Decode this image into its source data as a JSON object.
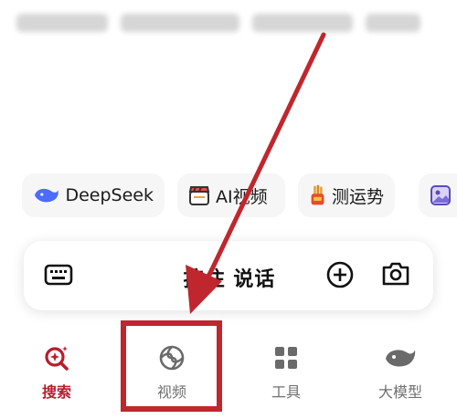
{
  "chips": [
    {
      "label": "DeepSeek",
      "icon": "whale-icon",
      "color": "#4d6bfe"
    },
    {
      "label": "AI视频",
      "icon": "clapperboard-icon",
      "color": "#e84b4b"
    },
    {
      "label": "测运势",
      "icon": "fortune-sticks-icon",
      "color": "#e8a23a"
    },
    {
      "label": "",
      "icon": "image-icon",
      "color": "#7a6bd6"
    }
  ],
  "voice": {
    "label": "按住 说话",
    "keyboard_icon": "keyboard-icon",
    "plus_icon": "plus-circle-icon",
    "camera_icon": "camera-icon"
  },
  "nav": {
    "items": [
      {
        "label": "搜索",
        "icon": "search-sparkle-icon",
        "active": true
      },
      {
        "label": "视频",
        "icon": "video-swirl-icon",
        "active": false
      },
      {
        "label": "工具",
        "icon": "grid-tools-icon",
        "active": false
      },
      {
        "label": "大模型",
        "icon": "whale-model-icon",
        "active": false
      }
    ]
  },
  "colors": {
    "accent": "#b81e2e",
    "annotation": "#c0262d",
    "inactive": "#707070"
  }
}
